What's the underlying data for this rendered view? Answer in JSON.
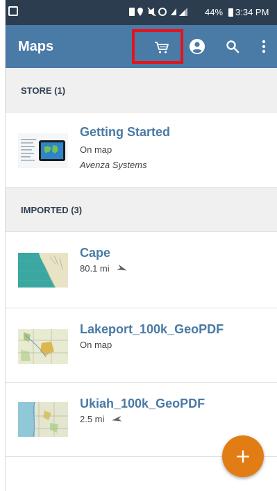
{
  "status_bar": {
    "battery": "44%",
    "time": "3:34 PM",
    "icons": [
      "wifi-icon",
      "phone-icon",
      "location-icon",
      "mute-icon",
      "alarm-icon",
      "signal-icon",
      "battery-icon"
    ]
  },
  "app_bar": {
    "title": "Maps",
    "actions": [
      "cart-icon",
      "account-icon",
      "search-icon",
      "more-vert-icon"
    ],
    "highlight_color": "#e3141b"
  },
  "sections": {
    "store": {
      "header": "STORE (1)",
      "items": [
        {
          "title": "Getting Started",
          "status": "On map",
          "publisher": "Avenza Systems"
        }
      ]
    },
    "imported": {
      "header": "IMPORTED (3)",
      "items": [
        {
          "title": "Cape",
          "status": "80.1 mi"
        },
        {
          "title": "Lakeport_100k_GeoPDF",
          "status": "On map"
        },
        {
          "title": "Ukiah_100k_GeoPDF",
          "status": "2.5 mi"
        }
      ]
    }
  },
  "fab": {
    "label": "+"
  },
  "colors": {
    "status_bar": "#2c3d4f",
    "app_bar": "#4a7aa6",
    "title_text": "#4a7aa6",
    "fab": "#e17d14"
  }
}
